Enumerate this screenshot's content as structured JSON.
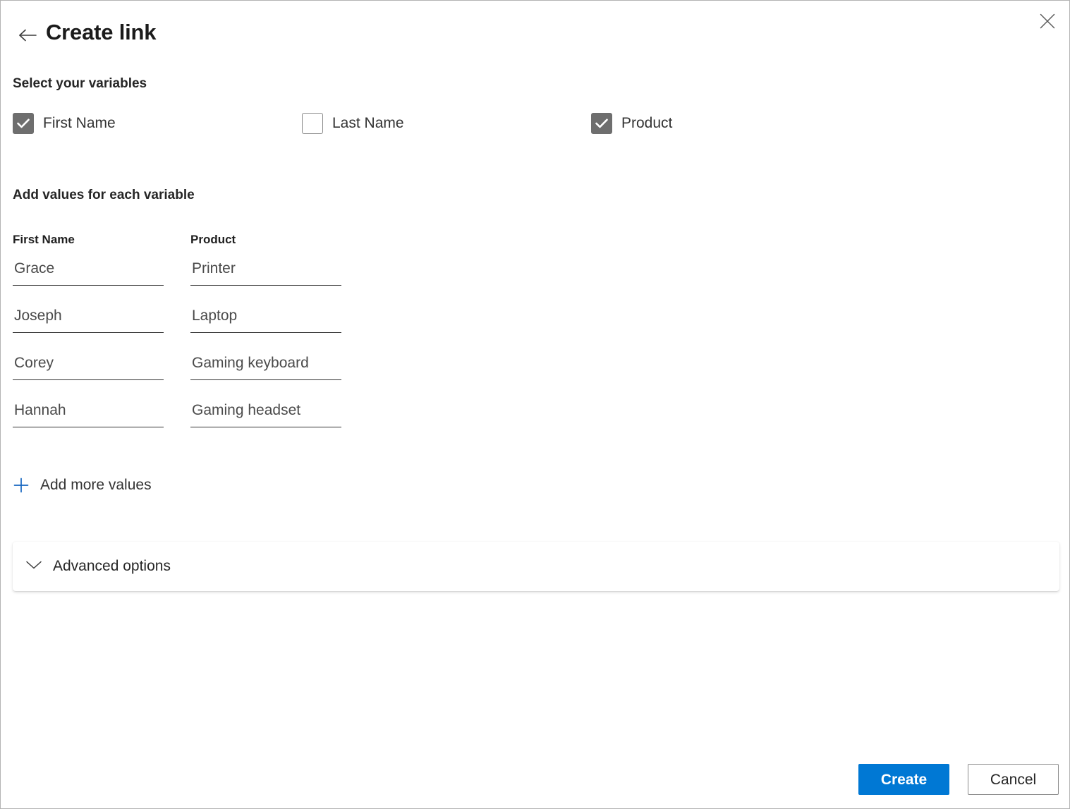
{
  "header": {
    "title": "Create link",
    "back_icon": "arrow-left-icon",
    "close_icon": "close-icon"
  },
  "variables_section": {
    "heading": "Select your variables",
    "checkboxes": [
      {
        "label": "First Name",
        "checked": true
      },
      {
        "label": "Last Name",
        "checked": false
      },
      {
        "label": "Product",
        "checked": true
      }
    ]
  },
  "values_section": {
    "heading": "Add values for each variable",
    "columns": [
      {
        "header": "First Name",
        "values": [
          "Grace",
          "Joseph",
          "Corey",
          "Hannah"
        ],
        "placeholder": ""
      },
      {
        "header": "Product",
        "values": [
          "Printer",
          "Laptop",
          "Gaming keyboard",
          "Gaming headset"
        ],
        "placeholder": ""
      }
    ],
    "add_more_label": "Add more values",
    "add_more_icon": "plus-icon"
  },
  "advanced": {
    "label": "Advanced options",
    "chevron_icon": "chevron-down-icon",
    "expanded": false
  },
  "footer": {
    "create_label": "Create",
    "cancel_label": "Cancel"
  },
  "colors": {
    "accent": "#0078d4",
    "checkbox_checked": "#6e6e6e",
    "text_primary": "#1b1b1b",
    "text_secondary": "#4a4a4a",
    "border": "#8a8a8a",
    "input_underline": "#323232"
  }
}
